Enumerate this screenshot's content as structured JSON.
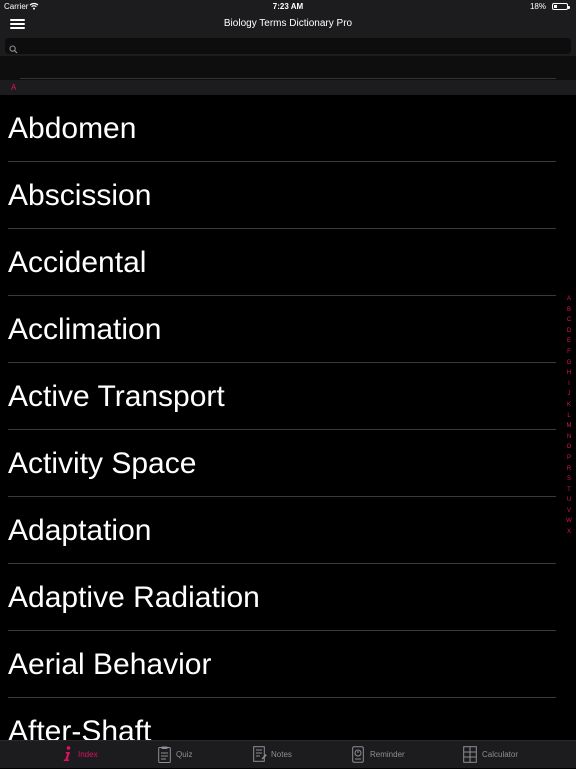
{
  "status_bar": {
    "carrier": "Carrier",
    "time": "7:23 AM",
    "battery": "18%"
  },
  "nav": {
    "title": "Biology Terms Dictionary Pro"
  },
  "search": {
    "value": "",
    "placeholder": ""
  },
  "section": {
    "header": "A"
  },
  "terms": [
    "Abdomen",
    "Abscission",
    "Accidental",
    "Acclimation",
    "Active Transport",
    "Activity Space",
    "Adaptation",
    "Adaptive Radiation",
    "Aerial Behavior",
    "After-Shaft"
  ],
  "index_letters": [
    "A",
    "B",
    "C",
    "D",
    "E",
    "F",
    "G",
    "H",
    "I",
    "J",
    "K",
    "L",
    "M",
    "N",
    "O",
    "P",
    "R",
    "S",
    "T",
    "U",
    "V",
    "W",
    "X"
  ],
  "tabs": [
    {
      "label": "Index",
      "icon": "info-icon",
      "active": true
    },
    {
      "label": "Quiz",
      "icon": "quiz-icon",
      "active": false
    },
    {
      "label": "Notes",
      "icon": "notes-icon",
      "active": false
    },
    {
      "label": "Reminder",
      "icon": "reminder-icon",
      "active": false
    },
    {
      "label": "Calculator",
      "icon": "calculator-icon",
      "active": false
    }
  ],
  "colors": {
    "accent": "#e0115f",
    "background": "#000000",
    "bar": "#1c1c1e"
  }
}
